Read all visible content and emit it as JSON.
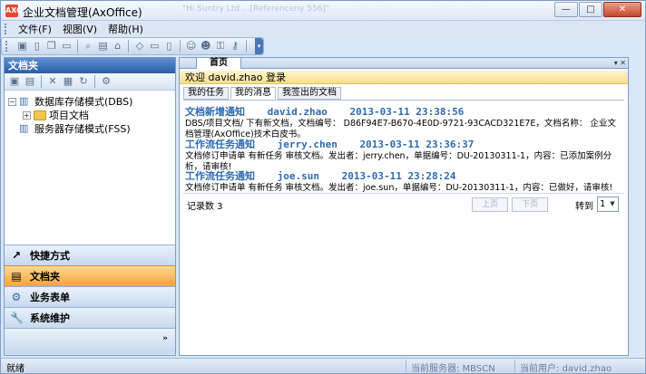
{
  "window": {
    "title": "企业文档管理(AxOffice)",
    "app_icon_label": "AXO",
    "ghost_text": "\"Hi Suntry Ltd ...[Referenceny 556]\"",
    "controls": {
      "minimize": "—",
      "maximize": "□",
      "close": "✕"
    }
  },
  "menu": {
    "items": [
      {
        "label": "文件(F)"
      },
      {
        "label": "视图(V)"
      },
      {
        "label": "帮助(H)"
      }
    ]
  },
  "toolbar": {
    "icons": [
      "folder-icon",
      "new-doc-icon",
      "copy-icon",
      "doc-icon",
      "preview-icon",
      "save-icon",
      "home-icon",
      "diamond-icon",
      "window-icon",
      "panel-icon",
      "user-icon",
      "users-icon",
      "lock-icon",
      "key-icon",
      "help-icon"
    ],
    "more": "▾"
  },
  "left_panel": {
    "title": "文档夹",
    "tools": [
      "open-folder-icon",
      "new-folder-icon",
      "delete-icon",
      "properties-icon",
      "refresh-icon",
      "settings-icon"
    ],
    "tree": [
      {
        "label": "数据库存储模式(DBS)",
        "expander": "−"
      },
      {
        "label": "项目文档",
        "expander": "+"
      },
      {
        "label": "服务器存储模式(FSS)",
        "expander": ""
      }
    ],
    "nav": [
      {
        "label": "快捷方式",
        "icon": "↗",
        "active": false
      },
      {
        "label": "文档夹",
        "icon": "▤",
        "active": true
      },
      {
        "label": "业务表单",
        "icon": "⚙",
        "active": false
      },
      {
        "label": "系统维护",
        "icon": "🔧",
        "active": false
      }
    ],
    "nav_more": "»"
  },
  "main": {
    "tab": "首页",
    "tab_controls": "▾ ✕",
    "welcome": "欢迎  david.zhao 登录",
    "subtabs": [
      {
        "label": "我的任务",
        "active": false
      },
      {
        "label": "我的消息",
        "active": true
      },
      {
        "label": "我签出的文档",
        "active": false
      }
    ],
    "messages": [
      {
        "type": "文档新增通知",
        "user": "david.zhao",
        "time": "2013-03-11 23:38:56",
        "body": "DBS/项目文档/ 下有新文档，文档编号： D86F94E7-B670-4E0D-9721-93CACD321E7E，文档名称： 企业文档管理(AxOffice)技术白皮书。"
      },
      {
        "type": "工作流任务通知",
        "user": "jerry.chen",
        "time": "2013-03-11 23:36:37",
        "body": "文档修订申请单 有新任务 审核文档。发出者：jerry.chen，单据编号：DU-20130311-1，内容：已添加案例分析，请审核!"
      },
      {
        "type": "工作流任务通知",
        "user": "joe.sun",
        "time": "2013-03-11 23:28:24",
        "body": "文档修订申请单 有新任务 审核文档。发出者：joe.sun，单据编号：DU-20130311-1，内容：已做好，请审核!"
      }
    ],
    "pager": {
      "records_label": "记录数 3",
      "prev": "上页",
      "next": "下页",
      "goto_label": "转到",
      "page": "1"
    }
  },
  "status": {
    "left": "就绪",
    "server": "当前服务器: MBSCN",
    "user": "当前用户: david.zhao"
  }
}
